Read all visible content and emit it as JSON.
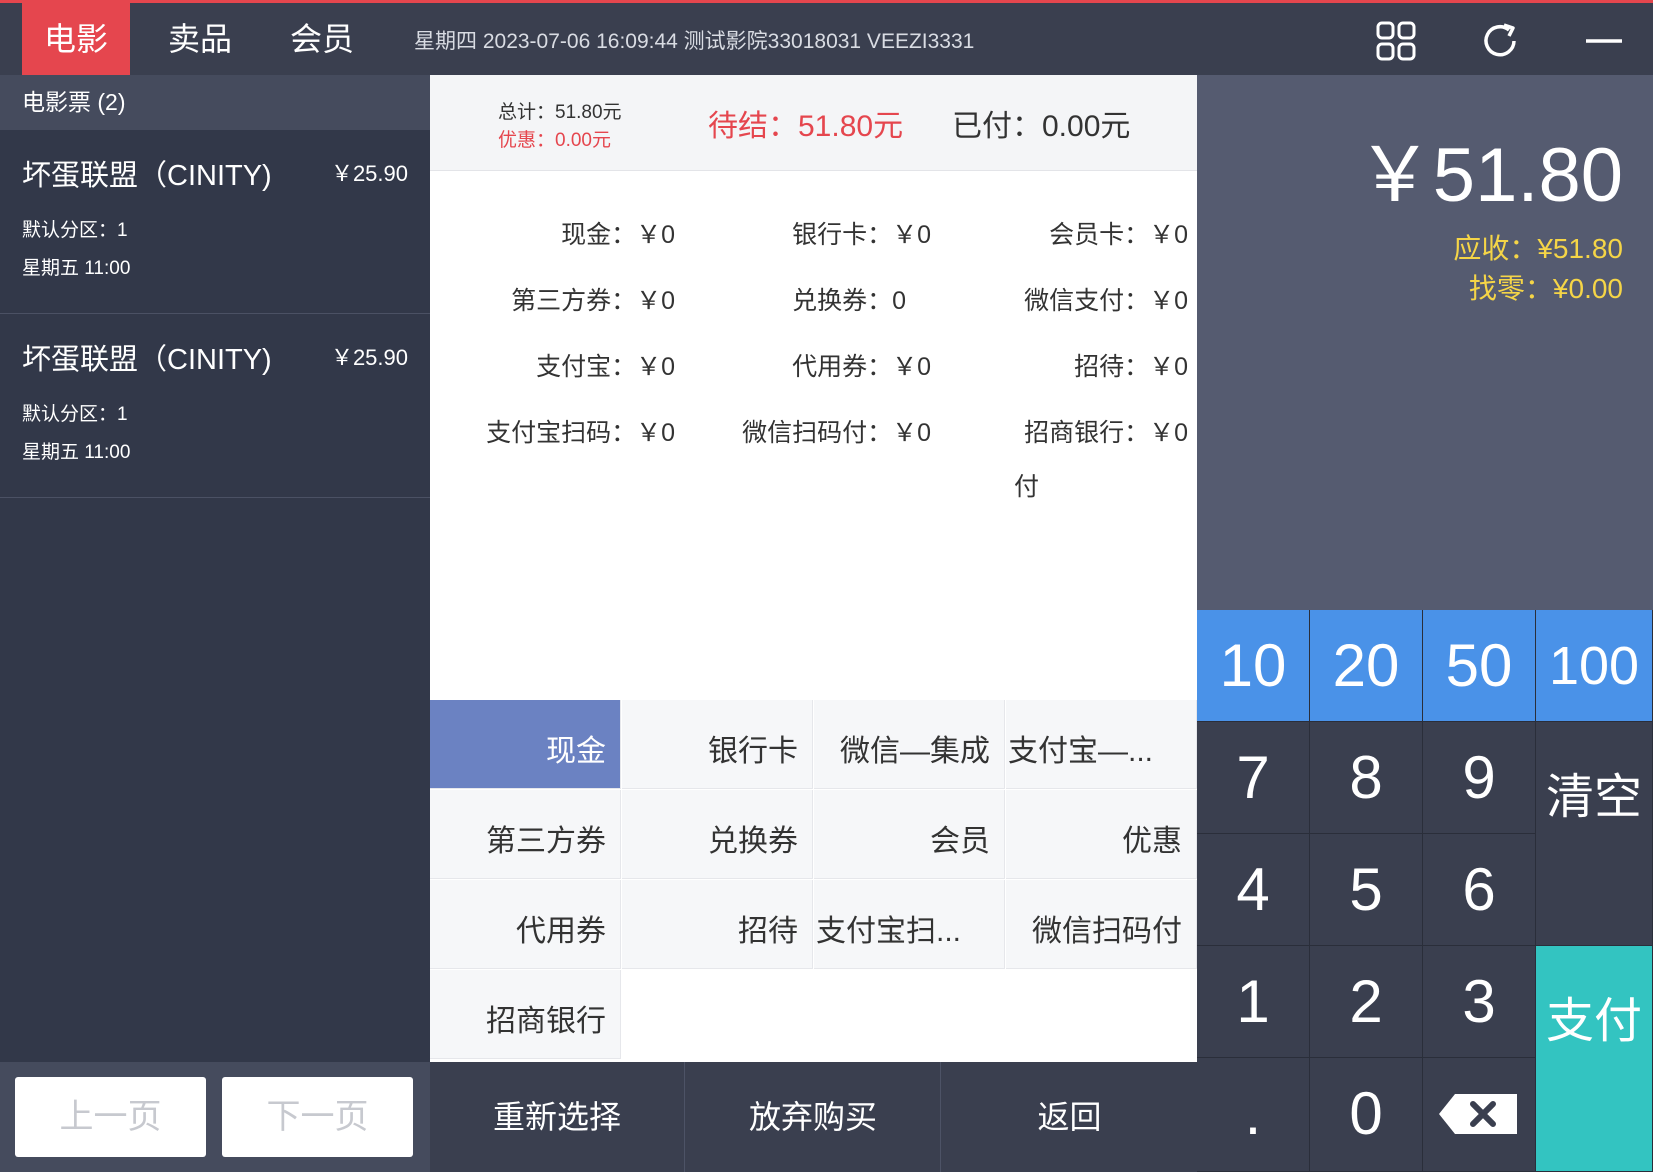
{
  "topbar": {
    "tabs": [
      "电影",
      "卖品",
      "会员"
    ],
    "info": "星期四 2023-07-06 16:09:44 测试影院33018031 VEEZI3331"
  },
  "left": {
    "header": "电影票 (2)",
    "tickets": [
      {
        "title": "坏蛋联盟（CINITY)",
        "price": "￥25.90",
        "zone": "默认分区：1",
        "time": "星期五 11:00"
      },
      {
        "title": "坏蛋联盟（CINITY)",
        "price": "￥25.90",
        "zone": "默认分区：1",
        "time": "星期五 11:00"
      }
    ],
    "pager": {
      "prev": "上一页",
      "next": "下一页"
    }
  },
  "summary": {
    "total": "总计：51.80元",
    "discount": "优惠：0.00元",
    "pending": "待结：51.80元",
    "paid": "已付：0.00元"
  },
  "payments": [
    [
      "现金：￥0",
      "银行卡：￥0",
      "会员卡：￥0"
    ],
    [
      "第三方券：￥0",
      "兑换券：0",
      "微信支付：￥0"
    ],
    [
      "支付宝：￥0",
      "代用券：￥0",
      "招待：￥0"
    ],
    [
      "支付宝扫码：￥0",
      "微信扫码付：￥0",
      "招商银行：￥0"
    ]
  ],
  "payment_wrap": "付",
  "methods": [
    "现金",
    "银行卡",
    "微信—集成",
    "支付宝—...",
    "第三方券",
    "兑换券",
    "会员",
    "优惠",
    "代用券",
    "招待",
    "支付宝扫...",
    "微信扫码付",
    "招商银行"
  ],
  "actions": [
    "重新选择",
    "放弃购买",
    "返回"
  ],
  "right": {
    "amount": "￥51.80",
    "due": "应收：¥51.80",
    "change": "找零：¥0.00"
  },
  "keypad": {
    "quick": [
      "10",
      "20",
      "50",
      "100"
    ],
    "digits": [
      "7",
      "8",
      "9",
      "4",
      "5",
      "6",
      "1",
      "2",
      "3",
      ".",
      "0"
    ],
    "clear": "清空",
    "pay": "支付"
  }
}
